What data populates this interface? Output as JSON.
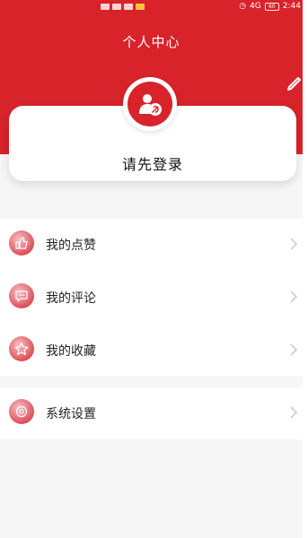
{
  "status_bar": {
    "network": "4G",
    "battery": "60",
    "time": "2:44"
  },
  "header": {
    "title": "个人中心"
  },
  "profile": {
    "login_prompt": "请先登录"
  },
  "menu": {
    "items": [
      {
        "label": "我的点赞",
        "icon": "thumbs-up-icon"
      },
      {
        "label": "我的评论",
        "icon": "comment-icon"
      },
      {
        "label": "我的收藏",
        "icon": "star-icon"
      },
      {
        "label": "系统设置",
        "icon": "settings-icon"
      }
    ]
  },
  "colors": {
    "primary": "#d8232a",
    "background": "#f6f6f6"
  }
}
